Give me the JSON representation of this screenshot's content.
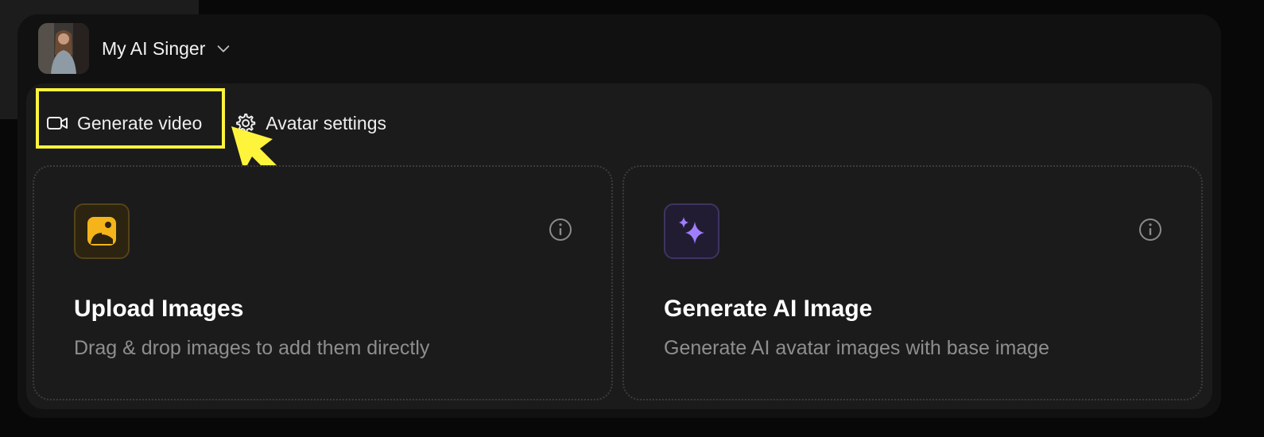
{
  "header": {
    "avatar_name": "avatar-image",
    "title": "My AI Singer"
  },
  "tabs": [
    {
      "label": "Generate video",
      "icon": "video-camera-icon"
    },
    {
      "label": "Avatar settings",
      "icon": "gear-icon"
    }
  ],
  "cards": [
    {
      "title": "Upload Images",
      "subtitle": "Drag & drop images to add them directly",
      "icon": "image-upload-icon",
      "accent": "#f4b41a"
    },
    {
      "title": "Generate AI Image",
      "subtitle": "Generate AI avatar images with base image",
      "icon": "sparkles-icon",
      "accent": "#a07dff"
    }
  ],
  "annotation": {
    "highlight_color": "#fff43c"
  }
}
